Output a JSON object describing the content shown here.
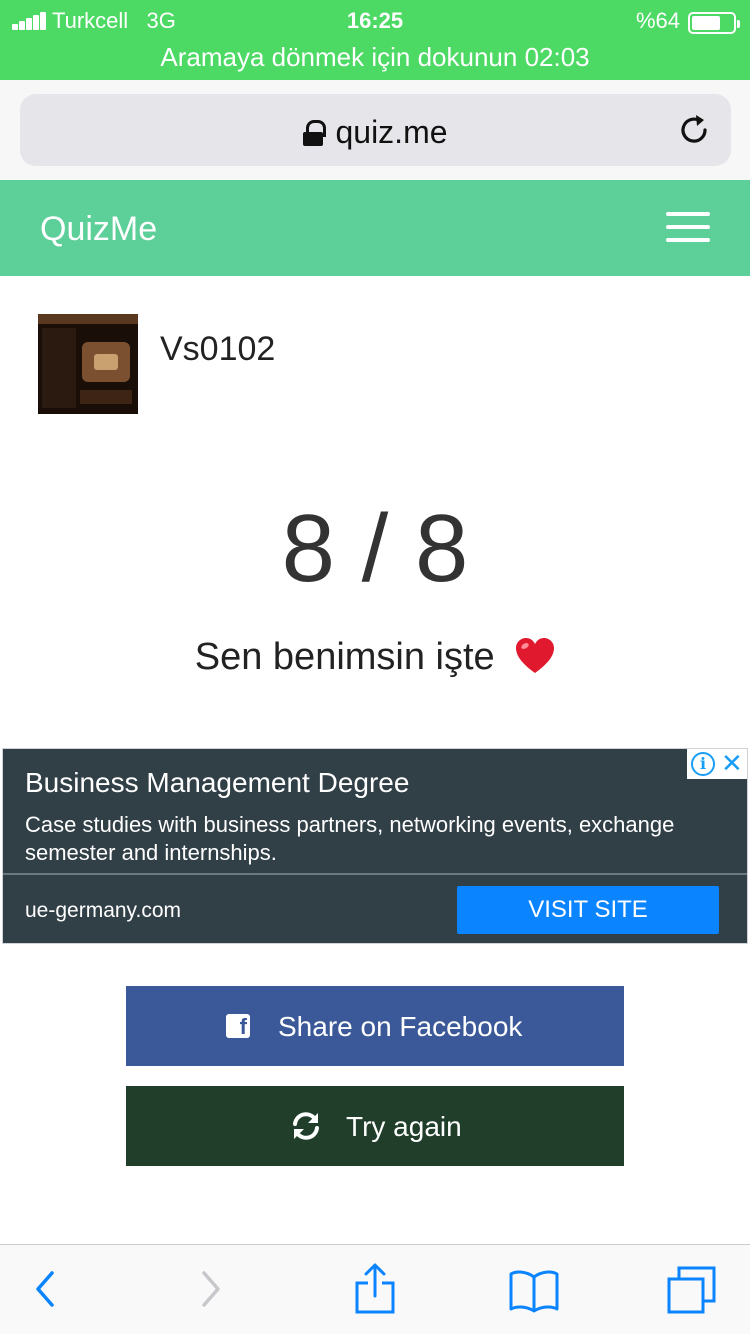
{
  "status_bar": {
    "carrier": "Turkcell",
    "network": "3G",
    "time": "16:25",
    "battery": "%64",
    "battery_level": 0.64,
    "call_banner": "Aramaya dönmek için dokunun 02:03"
  },
  "browser": {
    "url": "quiz.me"
  },
  "header": {
    "brand": "QuizMe"
  },
  "result": {
    "username": "Vs0102",
    "score": "8 / 8",
    "message": "Sen benimsin işte"
  },
  "ad": {
    "title": "Business Management Degree",
    "description": "Case studies with business partners, networking events, exchange semester and internships.",
    "domain": "ue-germany.com",
    "cta": "VISIT SITE"
  },
  "actions": {
    "share_label": "Share on Facebook",
    "retry_label": "Try again"
  },
  "colors": {
    "status_green": "#4cd964",
    "header_green": "#5dcf98",
    "facebook_blue": "#3b5998",
    "retry_green": "#213e2b",
    "ad_bg": "#313f47",
    "ad_button": "#0a84ff",
    "safari_blue": "#0a84ff"
  },
  "icons": {
    "lock": "lock-icon",
    "reload": "reload-icon",
    "menu": "hamburger-menu-icon",
    "heart": "heart-emoji",
    "facebook": "facebook-icon",
    "retry": "refresh-icon",
    "back": "chevron-left-icon",
    "forward": "chevron-right-icon",
    "share": "share-icon",
    "bookmarks": "book-icon",
    "tabs": "tabs-icon"
  }
}
